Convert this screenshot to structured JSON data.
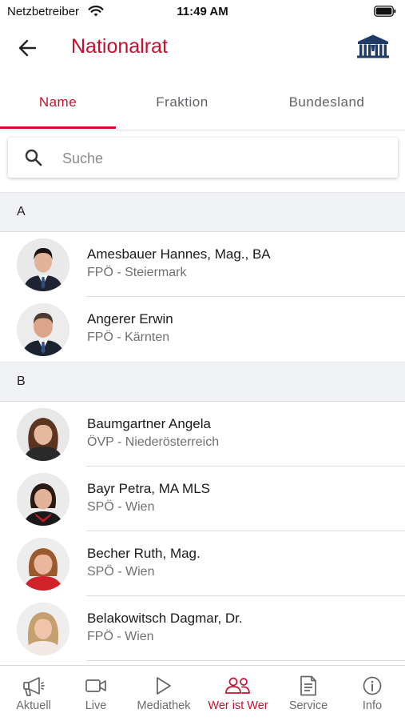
{
  "status_bar": {
    "carrier": "Netzbetreiber",
    "time": "11:49 AM"
  },
  "header": {
    "title": "Nationalrat"
  },
  "tabs": [
    {
      "label": "Name",
      "active": true
    },
    {
      "label": "Fraktion",
      "active": false
    },
    {
      "label": "Bundesland",
      "active": false
    }
  ],
  "search": {
    "placeholder": "Suche",
    "value": ""
  },
  "sections": [
    {
      "letter": "A",
      "members": [
        {
          "name": "Amesbauer Hannes, Mag., BA",
          "party": "FPÖ - Steiermark"
        },
        {
          "name": "Angerer Erwin",
          "party": "FPÖ - Kärnten"
        }
      ]
    },
    {
      "letter": "B",
      "members": [
        {
          "name": "Baumgartner Angela",
          "party": "ÖVP - Niederösterreich"
        },
        {
          "name": "Bayr Petra, MA MLS",
          "party": "SPÖ - Wien"
        },
        {
          "name": "Becher Ruth, Mag.",
          "party": "SPÖ - Wien"
        },
        {
          "name": "Belakowitsch Dagmar, Dr.",
          "party": "FPÖ - Wien"
        }
      ]
    }
  ],
  "bottom_nav": [
    {
      "label": "Aktuell",
      "icon": "megaphone-icon",
      "active": false
    },
    {
      "label": "Live",
      "icon": "video-camera-icon",
      "active": false
    },
    {
      "label": "Mediathek",
      "icon": "play-icon",
      "active": false
    },
    {
      "label": "Wer ist Wer",
      "icon": "people-icon",
      "active": true
    },
    {
      "label": "Service",
      "icon": "document-icon",
      "active": false
    },
    {
      "label": "Info",
      "icon": "info-icon",
      "active": false
    }
  ],
  "colors": {
    "accent": "#c8102e",
    "logo": "#1f3a64",
    "section_bg": "#f0f2f5"
  }
}
